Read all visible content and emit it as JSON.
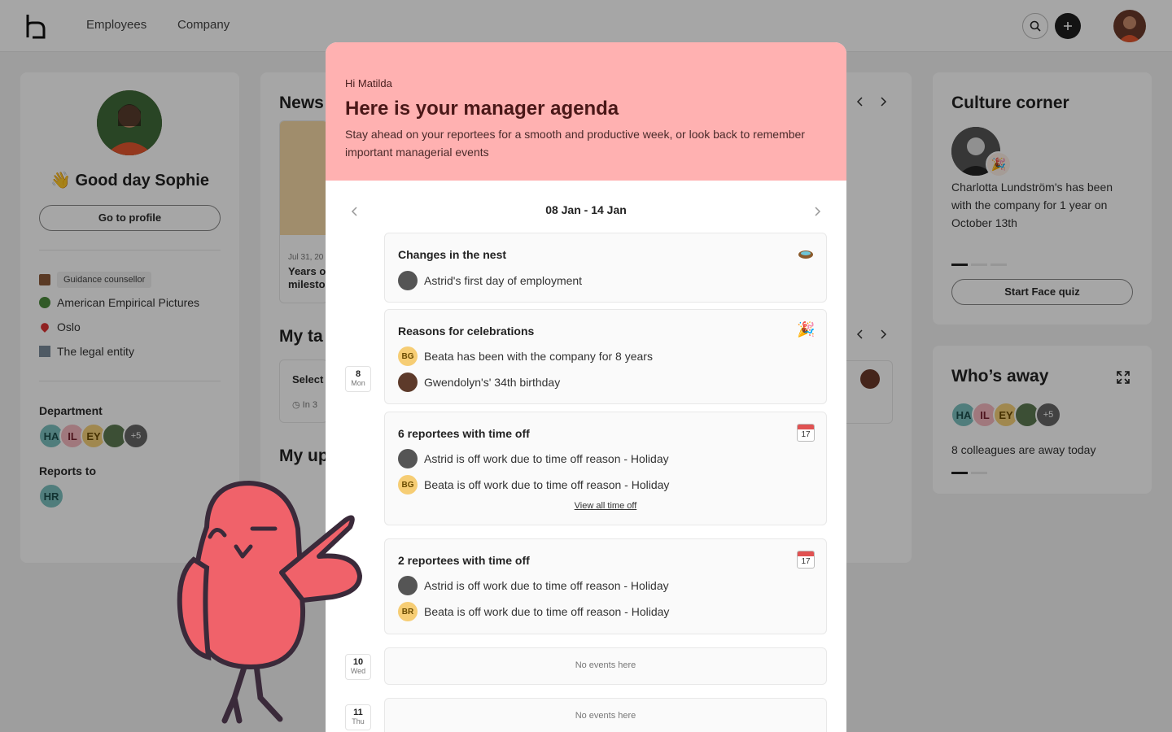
{
  "topbar": {
    "nav": [
      "Employees",
      "Company"
    ]
  },
  "profile": {
    "greeting": "👋 Good day Sophie",
    "profile_button": "Go to profile",
    "role": "Guidance counsellor",
    "company": "American Empirical Pictures",
    "location": "Oslo",
    "legal_entity": "The legal entity",
    "department_label": "Department",
    "department_avatars": [
      "HA",
      "IL",
      "EY",
      "",
      "+5"
    ],
    "reports_to_label": "Reports to",
    "reports_to": "HR"
  },
  "middle": {
    "news_title": "News",
    "news_date": "Jul 31, 20",
    "news_text_1": "Years o",
    "news_text_2": "milesto",
    "tasks_title": "My ta",
    "task_select": "Select",
    "task_in": "In 3",
    "updates_title": "My up"
  },
  "culture": {
    "title": "Culture corner",
    "text": "Charlotta Lundström's has been with the company for 1 year on October 13th",
    "button": "Start Face quiz"
  },
  "away": {
    "title": "Who’s away",
    "avatars": [
      "HA",
      "IL",
      "EY",
      "",
      "+5"
    ],
    "text": "8 colleagues are away today"
  },
  "modal": {
    "greeting": "Hi Matilda",
    "title": "Here is your manager agenda",
    "description": "Stay ahead on your reportees for a smooth and productive week, or look back to remember important managerial events",
    "week": "08 Jan - 14 Jan",
    "day_mon": {
      "num": "8",
      "name": "Mon"
    },
    "day_wed": {
      "num": "10",
      "name": "Wed"
    },
    "day_thu": {
      "num": "11",
      "name": "Thu"
    },
    "nest": {
      "title": "Changes in the nest",
      "row": "Astrid's first day of employment"
    },
    "celebrations": {
      "title": "Reasons for celebrations",
      "row1_av": "BG",
      "row1": "Beata has been with the company for 8 years",
      "row2": "Gwendolyn's' 34th birthday"
    },
    "timeoff6": {
      "title": "6 reportees with time off",
      "row1": "Astrid is off work due to time off reason - Holiday",
      "row2_av": "BG",
      "row2": "Beata is off work due to time off reason - Holiday",
      "view_all": "View all time off",
      "cal_num": "17"
    },
    "timeoff2": {
      "title": "2 reportees with time off",
      "row1": "Astrid is off work due to time off reason - Holiday",
      "row2_av": "BR",
      "row2": "Beata is off work due to time off reason - Holiday",
      "cal_num": "17"
    },
    "empty": "No events here"
  },
  "colors": {
    "modal_header": "#ffb1b1",
    "bird": "#f0626a",
    "overlay": "rgba(0,0,0,0.35)"
  }
}
